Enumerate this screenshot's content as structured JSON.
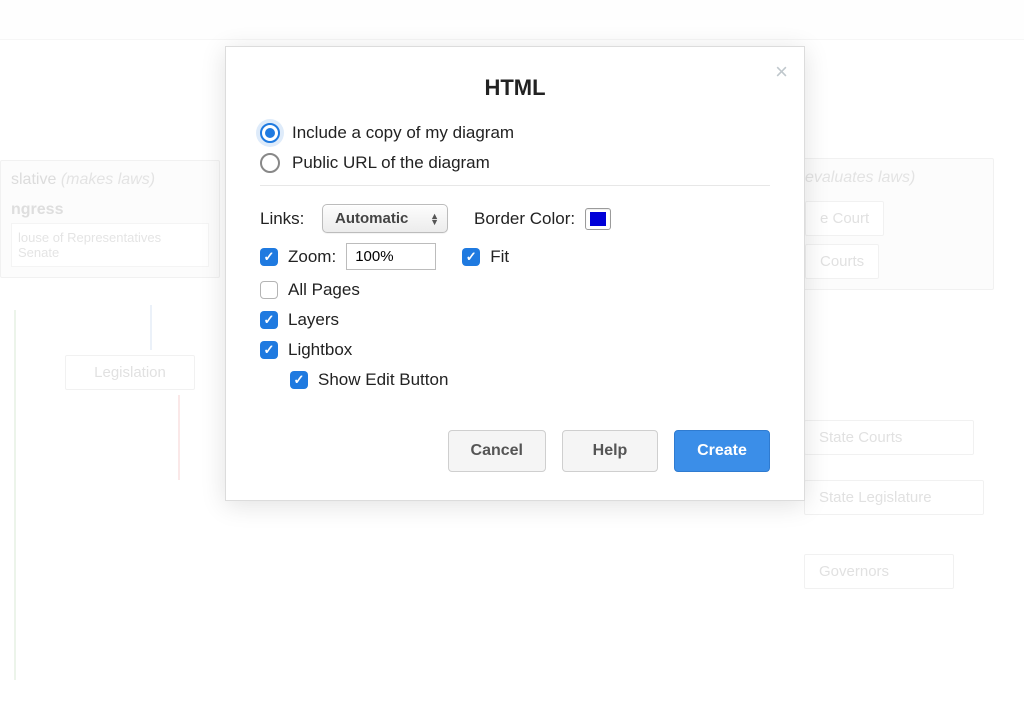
{
  "modal": {
    "title": "HTML",
    "radio_options": {
      "include_copy": "Include a copy of my diagram",
      "public_url": "Public URL of the diagram"
    },
    "links_label": "Links:",
    "links_value": "Automatic",
    "border_color_label": "Border Color:",
    "border_color_value": "#0000d8",
    "zoom_label": "Zoom:",
    "zoom_value": "100%",
    "fit_label": "Fit",
    "all_pages_label": "All Pages",
    "layers_label": "Layers",
    "lightbox_label": "Lightbox",
    "show_edit_label": "Show Edit Button",
    "buttons": {
      "cancel": "Cancel",
      "help": "Help",
      "create": "Create"
    }
  },
  "background": {
    "left_box_title": "slative",
    "left_box_sub": "(makes laws)",
    "congress": "ngress",
    "house": "louse of Representatives",
    "senate": "Senate",
    "legislation": "Legislation",
    "right_box_sub": "evaluates laws)",
    "court_chip1": "e Court",
    "court_chip2": "Courts",
    "state_courts": "State Courts",
    "state_legislature": "State Legislature",
    "governors": "Governors"
  }
}
